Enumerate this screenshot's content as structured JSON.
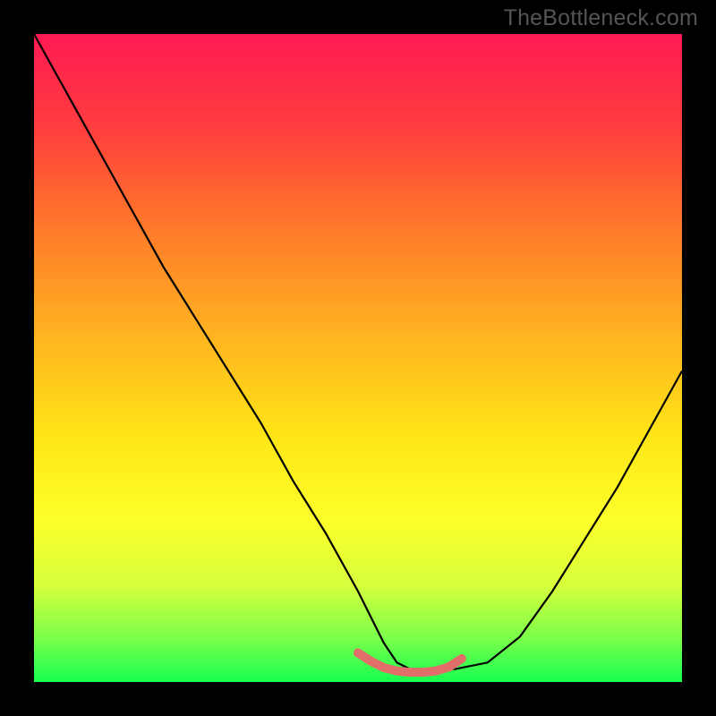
{
  "watermark": "TheBottleneck.com",
  "chart_data": {
    "type": "line",
    "title": "",
    "xlabel": "",
    "ylabel": "",
    "xlim": [
      0,
      100
    ],
    "ylim": [
      0,
      100
    ],
    "grid": false,
    "legend": false,
    "series": [
      {
        "name": "bottleneck-curve",
        "x": [
          0,
          5,
          10,
          15,
          20,
          25,
          30,
          35,
          40,
          45,
          50,
          52,
          54,
          56,
          58,
          60,
          65,
          70,
          75,
          80,
          85,
          90,
          95,
          100
        ],
        "values": [
          100,
          91,
          82,
          73,
          64,
          56,
          48,
          40,
          31,
          23,
          14,
          10,
          6,
          3,
          2,
          2,
          2,
          3,
          7,
          14,
          22,
          30,
          39,
          48
        ]
      },
      {
        "name": "benchmark-region",
        "x": [
          50,
          52,
          54,
          56,
          58,
          60,
          62,
          64,
          66
        ],
        "values": [
          4.5,
          3.2,
          2.2,
          1.7,
          1.5,
          1.5,
          1.7,
          2.3,
          3.6
        ]
      }
    ],
    "colors": {
      "curve": "#000000",
      "benchmark": "#e26e6a"
    }
  }
}
